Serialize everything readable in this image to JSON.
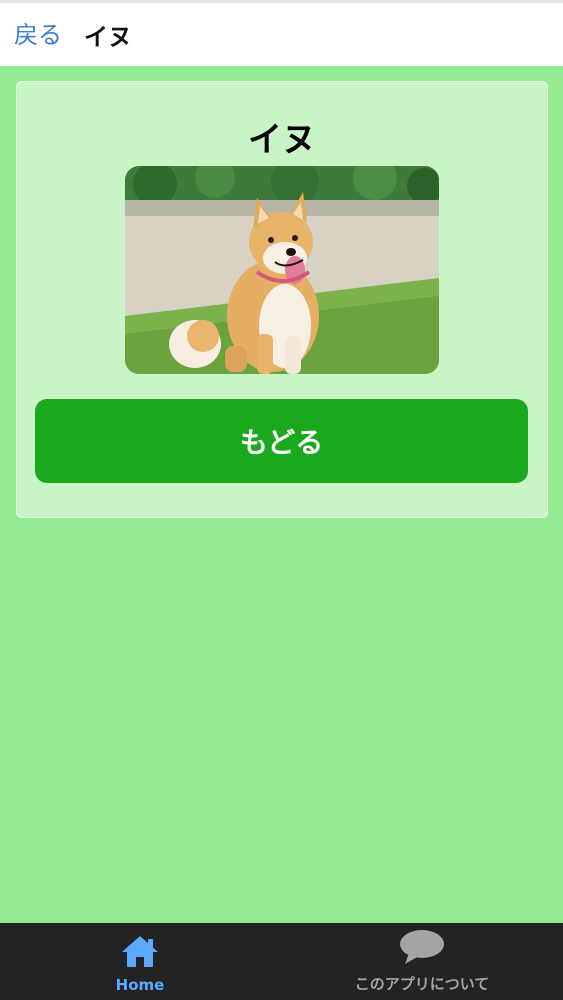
{
  "header": {
    "back_label": "戻る",
    "title": "イヌ"
  },
  "card": {
    "title": "イヌ",
    "button_label": "もどる"
  },
  "tabbar": {
    "items": [
      {
        "label": "Home",
        "icon": "home-icon",
        "active": true
      },
      {
        "label": "このアプリについて",
        "icon": "speech-bubble-icon",
        "active": false
      }
    ]
  },
  "colors": {
    "background": "#95ec92",
    "card": "#c8f4c6",
    "button": "#1aa81e",
    "link": "#3a7bd5",
    "tab_active": "#5aa8ff",
    "tab_inactive": "#a5a5a5",
    "tabbar": "#222325"
  }
}
